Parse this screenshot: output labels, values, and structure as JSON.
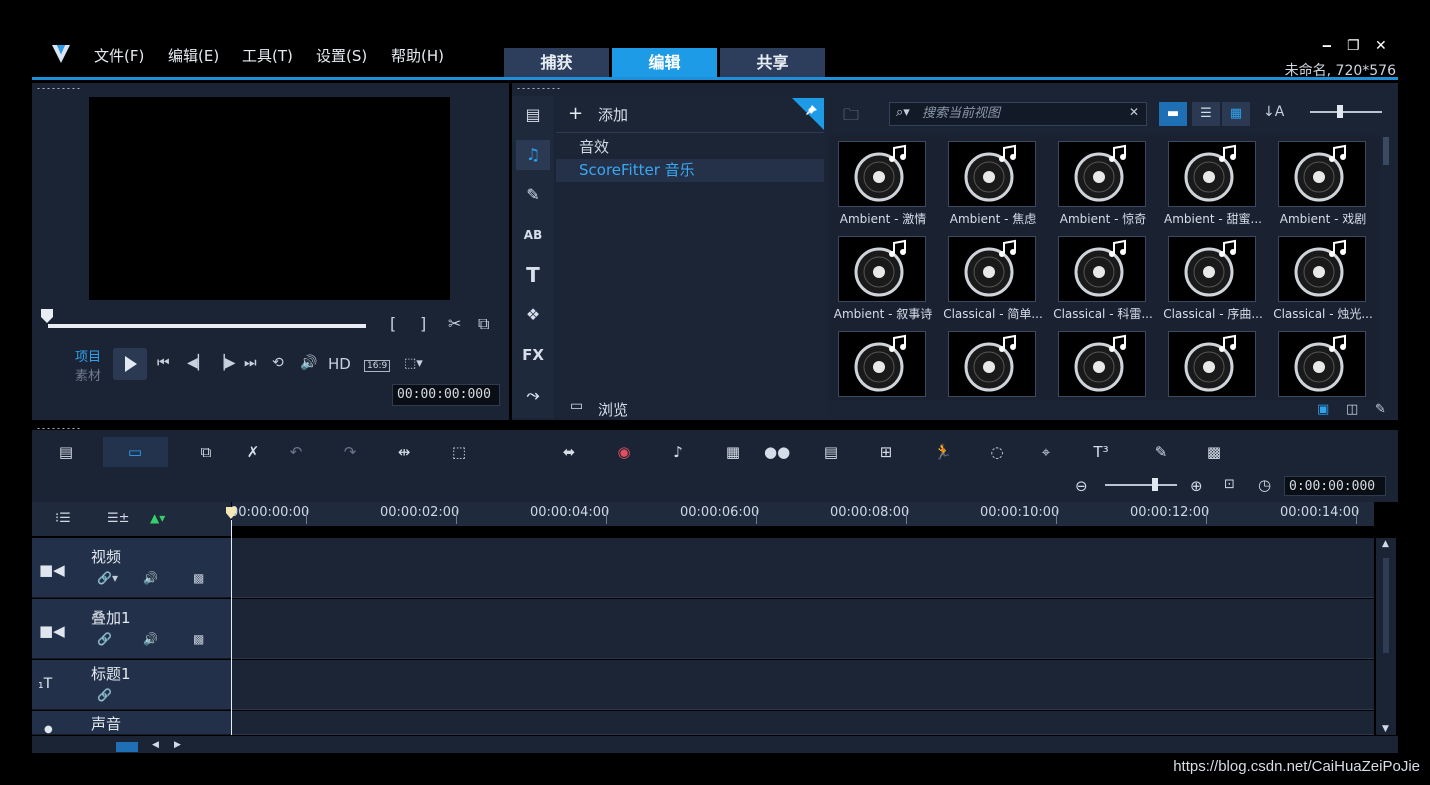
{
  "menu": [
    "文件(F)",
    "编辑(E)",
    "工具(T)",
    "设置(S)",
    "帮助(H)"
  ],
  "tabs": [
    {
      "label": "捕获",
      "active": false
    },
    {
      "label": "编辑",
      "active": true
    },
    {
      "label": "共享",
      "active": false
    }
  ],
  "project_info": "未命名, 720*576",
  "player": {
    "mode_project": "项目",
    "mode_clip": "素材",
    "hd_label": "HD",
    "aspect_label": "16:9",
    "timecode": "00:00:00:000"
  },
  "library": {
    "add_label": "添加",
    "categories": [
      {
        "label": "音效",
        "selected": false
      },
      {
        "label": "ScoreFitter 音乐",
        "selected": true
      }
    ],
    "browse_label": "浏览",
    "search_placeholder": "搜索当前视图",
    "thumbnails": [
      "Ambient - 激情",
      "Ambient - 焦虑",
      "Ambient - 惊奇",
      "Ambient - 甜蜜...",
      "Ambient - 戏剧",
      "Ambient - 叙事诗",
      "Classical - 简单...",
      "Classical - 科雷...",
      "Classical - 序曲...",
      "Classical - 烛光...",
      "",
      "",
      "",
      "",
      ""
    ]
  },
  "timeline": {
    "timecode": "0:00:00:000",
    "ruler": [
      "00:00:00:00",
      "00:00:02:00",
      "00:00:04:00",
      "00:00:06:00",
      "00:00:08:00",
      "00:00:10:00",
      "00:00:12:00",
      "00:00:14:00"
    ],
    "tracks": [
      {
        "name": "视频"
      },
      {
        "name": "叠加1"
      },
      {
        "name": "标题1"
      },
      {
        "name": "声音"
      }
    ]
  },
  "watermark": "https://blog.csdn.net/CaiHuaZeiPoJie",
  "colors": {
    "accent": "#1e9be6",
    "panel": "#1b2435",
    "selection": "#3aa8ef"
  }
}
